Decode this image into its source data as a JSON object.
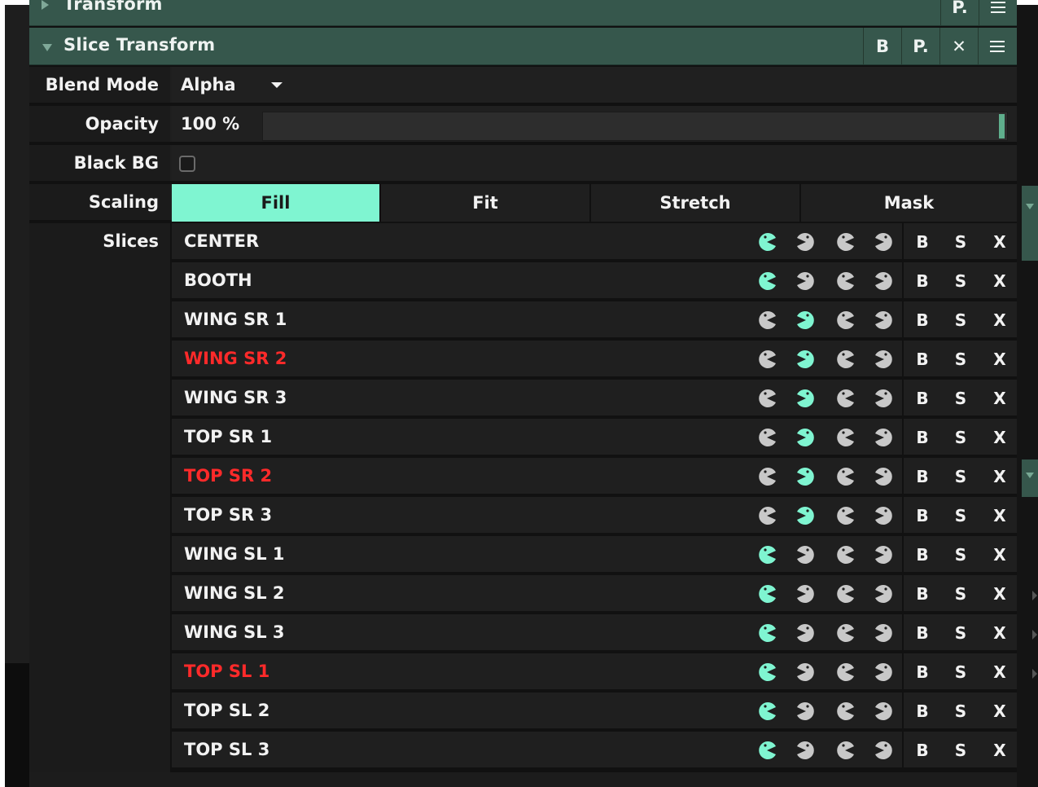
{
  "colors": {
    "accent": "#7ff5d1",
    "header": "#36574c",
    "inactive_icon": "#c8c8c8",
    "error_text": "#ff2a2a",
    "text": "#f2f2f2"
  },
  "collapsed_header": {
    "title": "Transform",
    "p_label": "P."
  },
  "header": {
    "title": "Slice Transform",
    "b_label": "B",
    "p_label": "P.",
    "close_label": "✕"
  },
  "blend_mode": {
    "label": "Blend Mode",
    "value": "Alpha"
  },
  "opacity": {
    "label": "Opacity",
    "value": "100 %",
    "level": 1.0
  },
  "black_bg": {
    "label": "Black BG",
    "checked": false
  },
  "scaling": {
    "label": "Scaling",
    "options": [
      "Fill",
      "Fit",
      "Stretch",
      "Mask"
    ],
    "selected": "Fill"
  },
  "slices": {
    "label": "Slices",
    "button_labels": {
      "b": "B",
      "s": "S",
      "x": "X"
    },
    "items": [
      {
        "name": "CENTER",
        "color": "#f2f2f2",
        "active": [
          true,
          false,
          false,
          false
        ]
      },
      {
        "name": "BOOTH",
        "color": "#f2f2f2",
        "active": [
          true,
          false,
          false,
          false
        ]
      },
      {
        "name": "WING SR 1",
        "color": "#f2f2f2",
        "active": [
          false,
          true,
          false,
          false
        ]
      },
      {
        "name": "WING SR 2",
        "color": "#ff2a2a",
        "active": [
          false,
          true,
          false,
          false
        ]
      },
      {
        "name": "WING SR 3",
        "color": "#f2f2f2",
        "active": [
          false,
          true,
          false,
          false
        ]
      },
      {
        "name": "TOP SR 1",
        "color": "#f2f2f2",
        "active": [
          false,
          true,
          false,
          false
        ]
      },
      {
        "name": "TOP SR 2",
        "color": "#ff2a2a",
        "active": [
          false,
          true,
          false,
          false
        ]
      },
      {
        "name": "TOP SR 3",
        "color": "#f2f2f2",
        "active": [
          false,
          true,
          false,
          false
        ]
      },
      {
        "name": "WING SL 1",
        "color": "#f2f2f2",
        "active": [
          true,
          false,
          false,
          false
        ]
      },
      {
        "name": "WING SL 2",
        "color": "#f2f2f2",
        "active": [
          true,
          false,
          false,
          false
        ]
      },
      {
        "name": "WING SL 3",
        "color": "#f2f2f2",
        "active": [
          true,
          false,
          false,
          false
        ]
      },
      {
        "name": "TOP SL 1",
        "color": "#ff2a2a",
        "active": [
          true,
          false,
          false,
          false
        ]
      },
      {
        "name": "TOP SL 2",
        "color": "#f2f2f2",
        "active": [
          true,
          false,
          false,
          false
        ]
      },
      {
        "name": "TOP SL 3",
        "color": "#f2f2f2",
        "active": [
          true,
          false,
          false,
          false
        ]
      }
    ]
  }
}
